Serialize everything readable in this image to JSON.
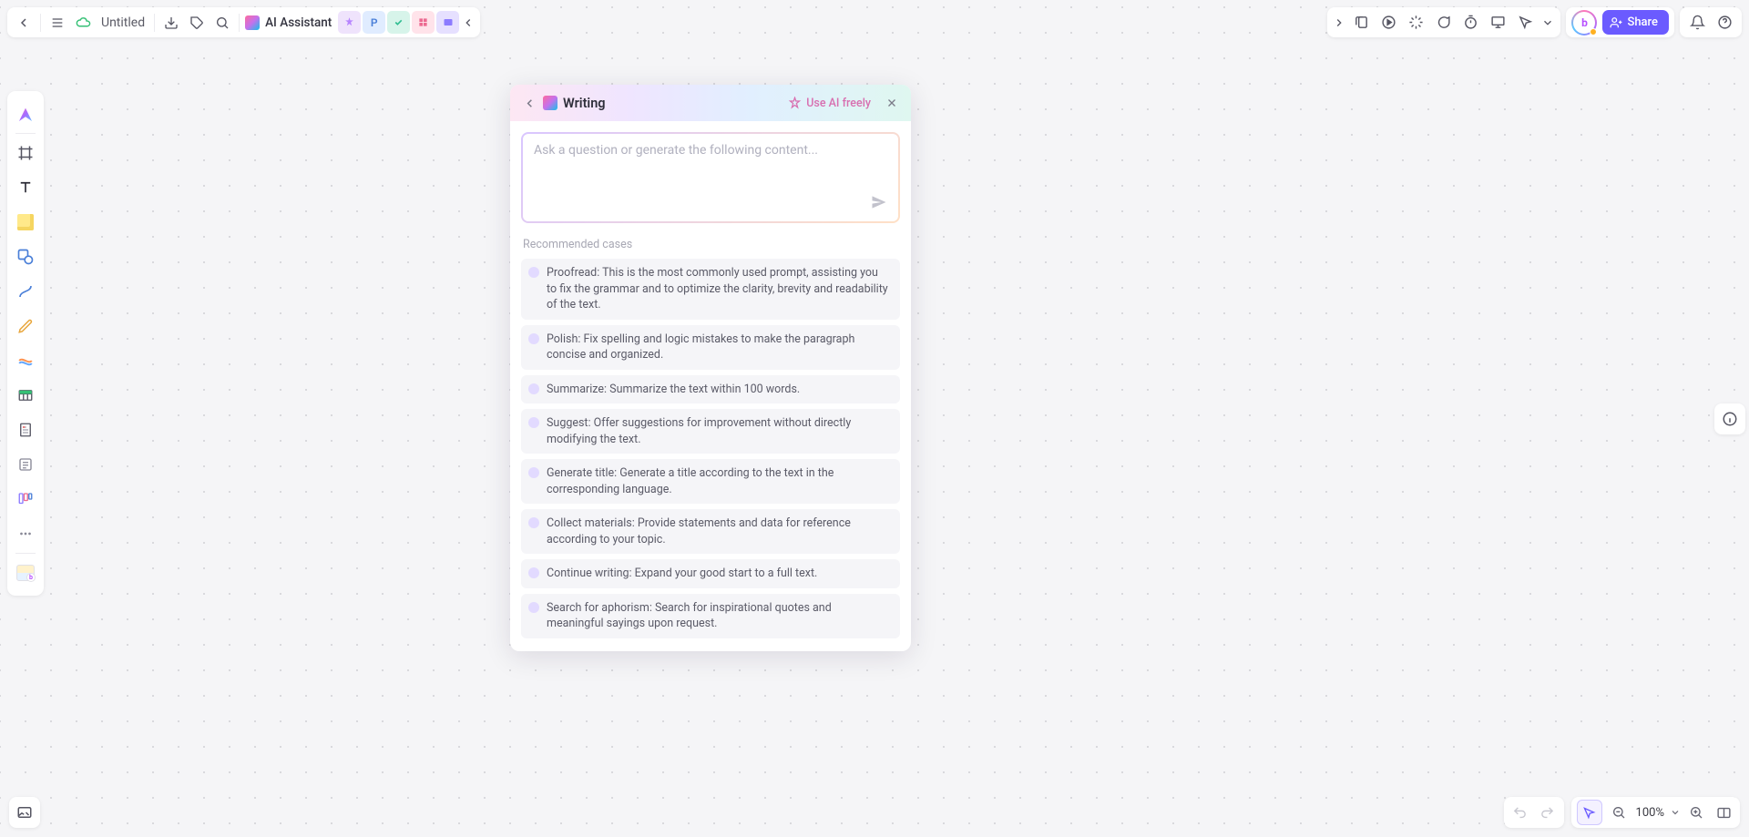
{
  "header": {
    "doc_title": "Untitled",
    "ai_label": "AI Assistant"
  },
  "share": {
    "label": "Share"
  },
  "avatar_letter": "b",
  "zoom": {
    "text": "100%"
  },
  "ai_panel": {
    "title": "Writing",
    "use_ai_freely": "Use AI freely",
    "placeholder": "Ask a question or generate the following content...",
    "recommended_title": "Recommended cases",
    "cases": [
      "Proofread: This is the most commonly used prompt, assisting you to fix the grammar and to optimize the clarity, brevity and readability of the text.",
      "Polish: Fix spelling and logic mistakes to make the paragraph concise and organized.",
      "Summarize: Summarize the text within 100 words.",
      "Suggest: Offer suggestions for improvement without directly modifying the text.",
      "Generate title: Generate a title according to the text in the corresponding language.",
      "Collect materials: Provide statements and data for reference according to your topic.",
      "Continue writing: Expand your good start to a full text.",
      "Search for aphorism: Search for inspirational quotes and meaningful sayings upon request."
    ]
  }
}
